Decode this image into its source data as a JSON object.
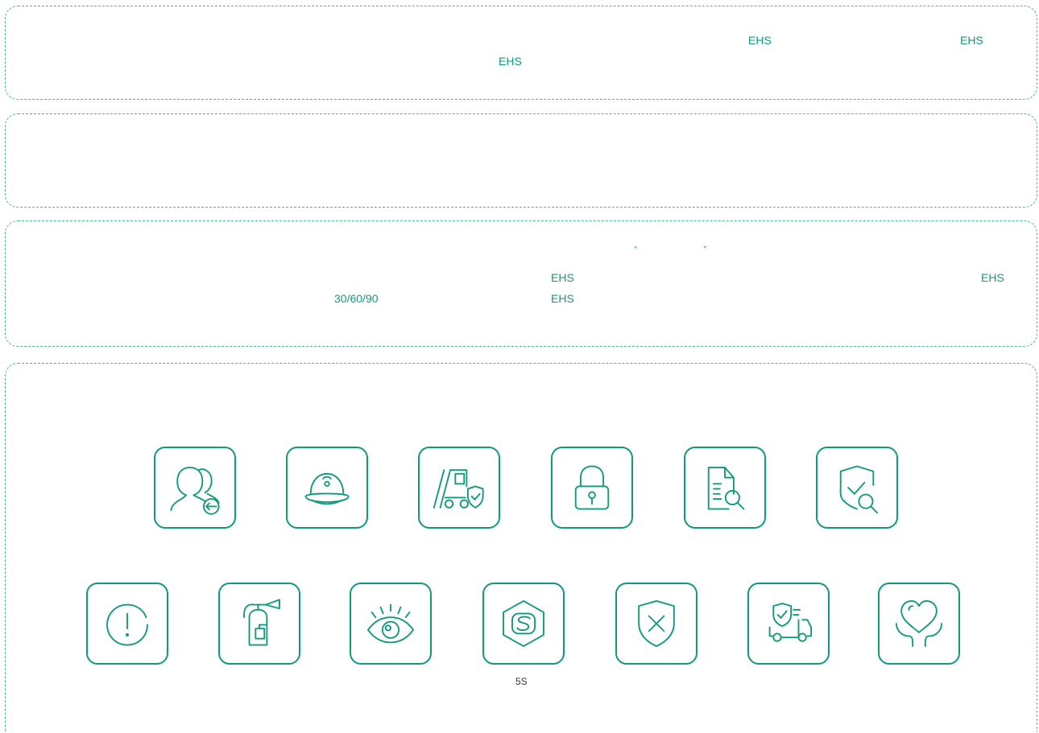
{
  "section_intro": {
    "text_1": "EHS",
    "text_2": "EHS",
    "text_3": "EHS"
  },
  "section_services": {
    "open_quote": "“",
    "close_quote": "”",
    "text_1": "EHS",
    "text_2": "EHS",
    "text_3": "30/60/90",
    "text_4": "EHS"
  },
  "icons": {
    "row1": [
      "people-return-icon",
      "hard-hat-icon",
      "forklift-shield-icon",
      "padlock-icon",
      "document-search-icon",
      "shield-check-search-icon"
    ],
    "row2": [
      "alert-circle-icon",
      "fire-extinguisher-icon",
      "eye-icon",
      "5s-hexagon-icon",
      "shield-x-icon",
      "truck-shield-icon",
      "heart-hands-icon"
    ],
    "caption_5s": "5S"
  },
  "colors": {
    "accent": "#109a7c",
    "border": "#4fb39a"
  }
}
